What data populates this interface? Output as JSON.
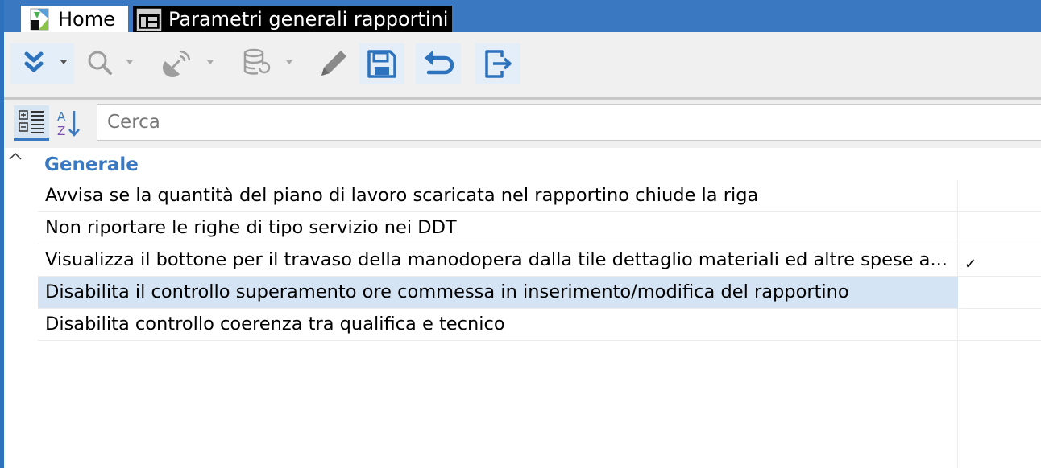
{
  "tabs": {
    "home": {
      "label": "Home",
      "icon": "home-app-icon"
    },
    "params": {
      "label": "Parametri generali rapportini",
      "icon": "window-layout-icon"
    }
  },
  "toolbar": {
    "items": [
      {
        "name": "expand-double-chevron-icon",
        "dropdown": true
      },
      {
        "name": "search-icon",
        "dropdown": true
      },
      {
        "name": "satellite-dish-icon",
        "dropdown": true
      },
      {
        "name": "database-refresh-icon",
        "dropdown": true
      },
      {
        "name": "pencil-edit-icon",
        "dropdown": false
      },
      {
        "name": "save-floppy-icon",
        "dropdown": false
      },
      {
        "name": "undo-arrow-icon",
        "dropdown": false
      },
      {
        "name": "exit-door-icon",
        "dropdown": false
      }
    ],
    "accent_color": "#2d72bd",
    "disabled_color": "#9e9e9e"
  },
  "search": {
    "placeholder": "Cerca",
    "categorized_view_icon": "categorized-view-icon",
    "sort_az_icon": "sort-az-icon"
  },
  "grid": {
    "category": "Generale",
    "collapse_icon": "chevron-up-icon",
    "rows": [
      {
        "label": "Avvisa se la quantità del piano di lavoro scaricata nel rapportino chiude la riga",
        "checked": false,
        "selected": false
      },
      {
        "label": "Non riportare le righe di tipo servizio nei DDT",
        "checked": false,
        "selected": false
      },
      {
        "label": "Visualizza il bottone per il travaso della manodopera dalla tile dettaglio materiali ed altre spese a...",
        "checked": true,
        "selected": false
      },
      {
        "label": "Disabilita il controllo superamento ore commessa in inserimento/modifica del rapportino",
        "checked": false,
        "selected": true
      },
      {
        "label": "Disabilita controllo coerenza tra qualifica e tecnico",
        "checked": false,
        "selected": false
      }
    ],
    "check_glyph": "✓"
  },
  "colors": {
    "titlebar": "#3a79c2",
    "selected_row": "#d4e4f4",
    "category_text": "#3a79c2"
  }
}
